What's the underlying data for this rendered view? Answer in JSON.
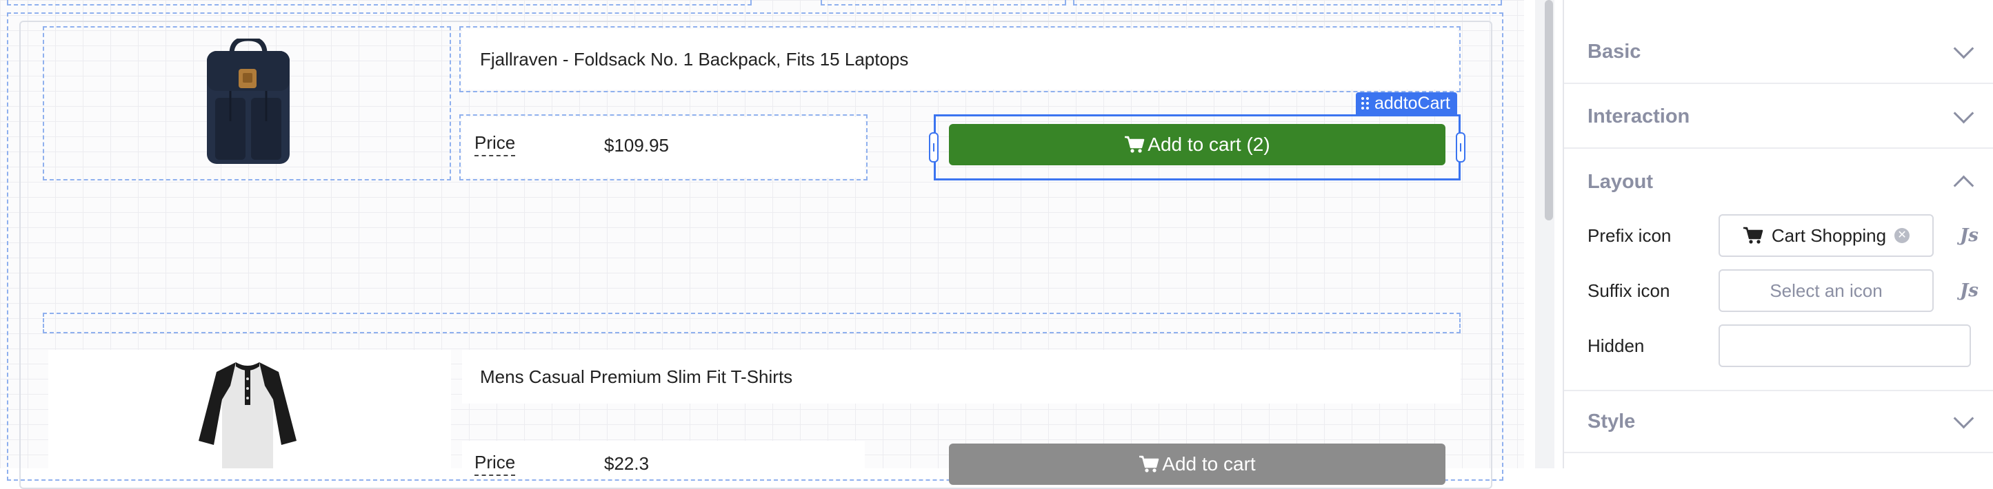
{
  "canvas": {
    "products": [
      {
        "title": "Fjallraven - Foldsack No. 1 Backpack, Fits 15 Laptops",
        "price_label": "Price",
        "price_value": "$109.95",
        "button_label": "Add to cart (2)",
        "button_icon": "cart-icon",
        "button_color": "#388527",
        "image": "backpack-image"
      },
      {
        "title": "Mens Casual Premium Slim Fit T-Shirts",
        "price_label": "Price",
        "price_value": "$22.3",
        "button_label": "Add to cart",
        "button_icon": "cart-icon",
        "button_color": "#8c8c8c",
        "image": "tshirt-image"
      }
    ],
    "selected_component": {
      "name": "addtoCart",
      "accent": "#3b74f0"
    }
  },
  "panel": {
    "sections": {
      "basic": "Basic",
      "interaction": "Interaction",
      "layout": "Layout",
      "style": "Style"
    },
    "layout": {
      "prefix_icon_label": "Prefix icon",
      "prefix_icon_value": "Cart Shopping",
      "suffix_icon_label": "Suffix icon",
      "suffix_icon_placeholder": "Select an icon",
      "hidden_label": "Hidden",
      "hidden_value": "",
      "js_mark": "Js"
    }
  }
}
